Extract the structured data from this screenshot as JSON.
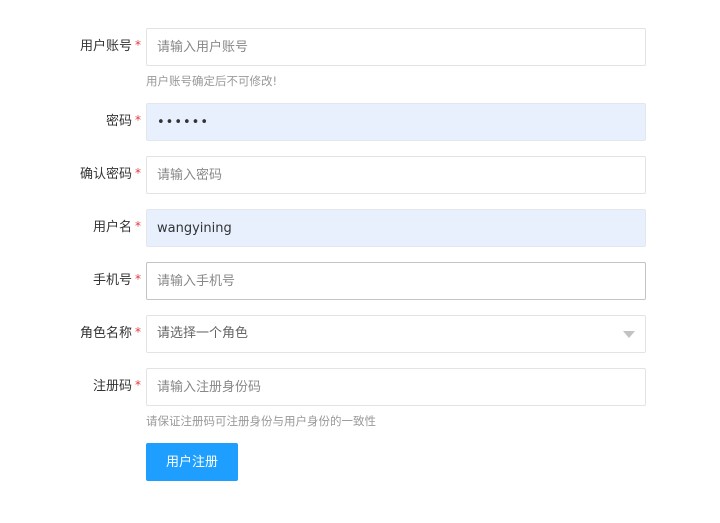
{
  "form": {
    "account": {
      "label": "用户账号",
      "required_mark": "*",
      "placeholder": "请输入用户账号",
      "value": "",
      "hint": "用户账号确定后不可修改!"
    },
    "password": {
      "label": "密码",
      "required_mark": "*",
      "value": "••••••"
    },
    "confirm_password": {
      "label": "确认密码",
      "required_mark": "*",
      "placeholder": "请输入密码",
      "value": ""
    },
    "username": {
      "label": "用户名",
      "required_mark": "*",
      "value": "wangyining"
    },
    "phone": {
      "label": "手机号",
      "required_mark": "*",
      "placeholder": "请输入手机号",
      "value": ""
    },
    "role": {
      "label": "角色名称",
      "required_mark": "*",
      "selected": "请选择一个角色",
      "caret_icon": "chevron-down-icon"
    },
    "reg_code": {
      "label": "注册码",
      "required_mark": "*",
      "placeholder": "请输入注册身份码",
      "value": "",
      "hint": "请保证注册码可注册身份与用户身份的一致性"
    },
    "submit_label": "用户注册"
  },
  "colors": {
    "primary_button": "#1e9fff",
    "required_mark": "#e4393c",
    "autofill_background": "#e8f0fe",
    "hint_text": "#999999"
  }
}
